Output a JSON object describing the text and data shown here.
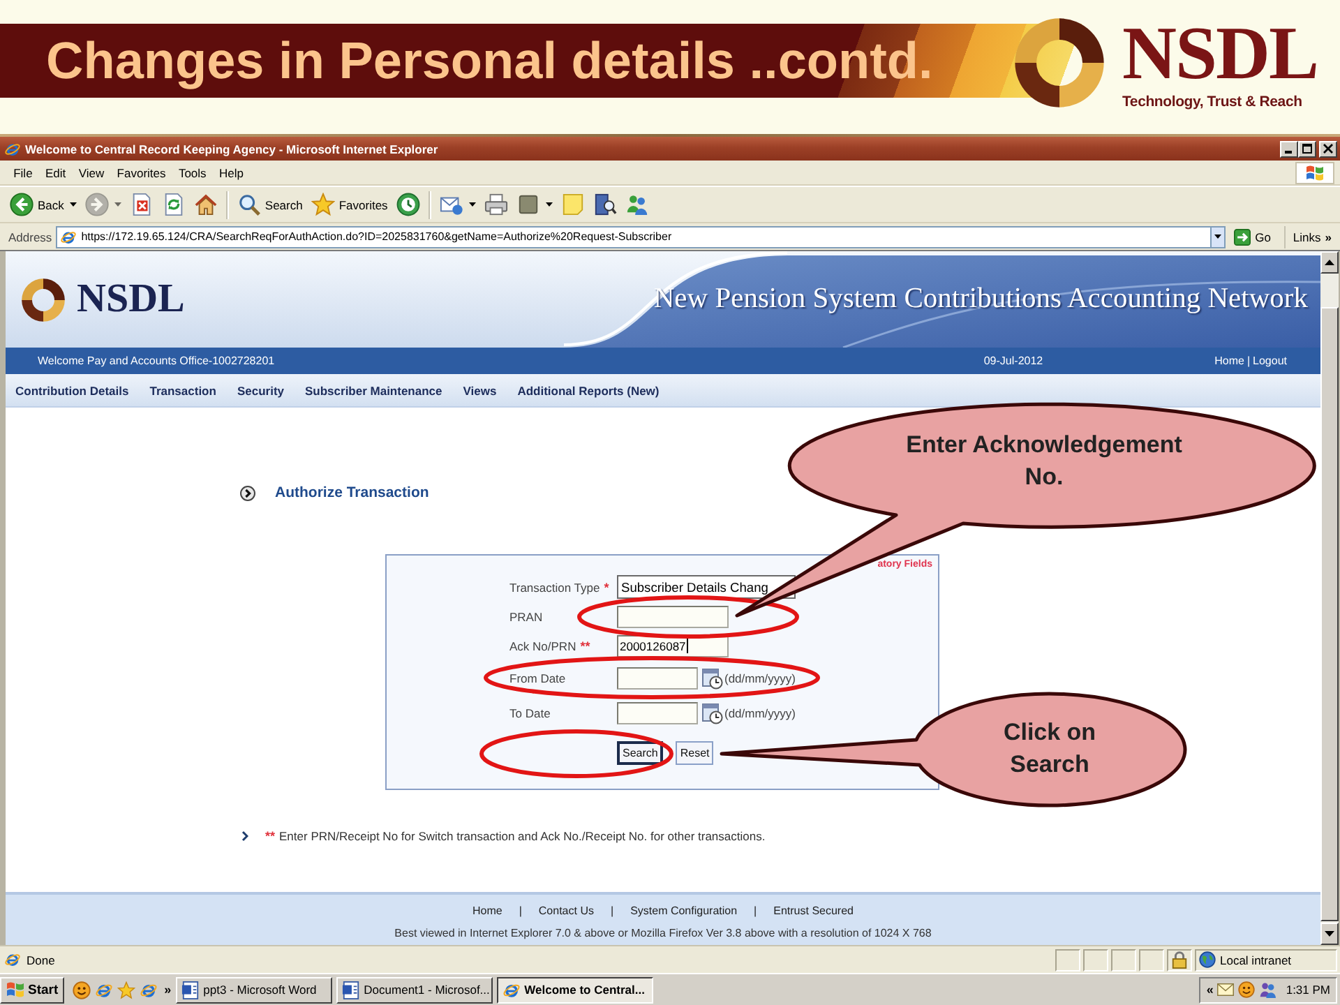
{
  "slide": {
    "title": "Changes in Personal details ..contd.",
    "brand": "NSDL",
    "tagline": "Technology, Trust & Reach"
  },
  "window": {
    "title": "Welcome to Central Record Keeping Agency - Microsoft Internet Explorer"
  },
  "menu": [
    "File",
    "Edit",
    "View",
    "Favorites",
    "Tools",
    "Help"
  ],
  "toolbar": [
    {
      "items": [
        {
          "kind": "back",
          "label": "Back",
          "dropdown": true,
          "disabled": false
        },
        {
          "kind": "forward",
          "dropdown": true,
          "disabled": true
        },
        {
          "kind": "stop",
          "dropdown": false,
          "disabled": false
        },
        {
          "kind": "refresh",
          "dropdown": false,
          "disabled": false
        },
        {
          "kind": "home",
          "dropdown": false,
          "disabled": false
        }
      ]
    },
    {
      "items": [
        {
          "kind": "search",
          "label": "Search",
          "dropdown": false,
          "disabled": false
        },
        {
          "kind": "favorites",
          "label": "Favorites",
          "dropdown": false,
          "disabled": false
        },
        {
          "kind": "history",
          "dropdown": false,
          "disabled": false
        }
      ]
    },
    {
      "items": [
        {
          "kind": "mail",
          "dropdown": true,
          "disabled": false
        },
        {
          "kind": "print",
          "dropdown": false,
          "disabled": false
        },
        {
          "kind": "square",
          "dropdown": true,
          "disabled": false
        },
        {
          "kind": "note",
          "dropdown": false,
          "disabled": false
        },
        {
          "kind": "research",
          "dropdown": false,
          "disabled": false
        },
        {
          "kind": "people",
          "dropdown": false,
          "disabled": false
        }
      ]
    }
  ],
  "address": {
    "label": "Address",
    "url": "https://172.19.65.124/CRA/SearchReqForAuthAction.do?ID=2025831760&getName=Authorize%20Request-Subscriber",
    "go": "Go",
    "links": "Links",
    "more": "»"
  },
  "page": {
    "banner": {
      "brand": "NSDL",
      "title": "New Pension System Contributions Accounting Network"
    },
    "info_bar": {
      "welcome": "Welcome Pay and Accounts Office-1002728201",
      "date": "09-Jul-2012",
      "links": [
        "Home",
        "Logout"
      ],
      "separator": "|"
    },
    "nav": [
      "Contribution Details",
      "Transaction",
      "Security",
      "Subscriber Maintenance",
      "Views",
      "Additional Reports (New)"
    ],
    "section_title": "Authorize Transaction",
    "form": {
      "note": "atory Fields",
      "fields": [
        {
          "kind": "select",
          "label": "Transaction Type",
          "marker": "*",
          "value": "Subscriber Details Chang",
          "focused": false
        },
        {
          "kind": "text",
          "label": "PRAN",
          "focused": false
        },
        {
          "kind": "text",
          "label": "Ack No/PRN",
          "marker": "**",
          "value": "2000126087",
          "focused": true
        },
        {
          "kind": "date",
          "label": "From Date",
          "format": "(dd/mm/yyyy)",
          "focused": false
        },
        {
          "kind": "date",
          "label": "To Date",
          "format": "(dd/mm/yyyy)",
          "focused": false
        }
      ],
      "buttons": [
        {
          "label": "Search",
          "default": true
        },
        {
          "label": "Reset",
          "default": false
        }
      ]
    },
    "hint": {
      "marker": "**",
      "text": "Enter PRN/Receipt No for Switch transaction and Ack No./Receipt No. for other transactions."
    },
    "footer": {
      "links": [
        "Home",
        "Contact Us",
        "System Configuration",
        "Entrust Secured"
      ],
      "separator": "|",
      "notice": "Best viewed in Internet Explorer 7.0 & above or Mozilla Firefox Ver 3.8 above with a resolution of 1024 X 768"
    }
  },
  "status_bar": {
    "text": "Done",
    "zone": "Local intranet"
  },
  "taskbar": {
    "start": "Start",
    "more": "»",
    "tasks": [
      {
        "kind": "word",
        "label": "ppt3 - Microsoft Word",
        "selected": false
      },
      {
        "kind": "word",
        "label": "Document1 - Microsof...",
        "selected": false
      },
      {
        "kind": "browser",
        "label": "Welcome to Central...",
        "selected": true
      }
    ],
    "tray_more": "«",
    "clock": "1:31 PM"
  },
  "callouts": [
    {
      "text": "Enter Acknowledgement No."
    },
    {
      "text": "Click on Search"
    }
  ]
}
